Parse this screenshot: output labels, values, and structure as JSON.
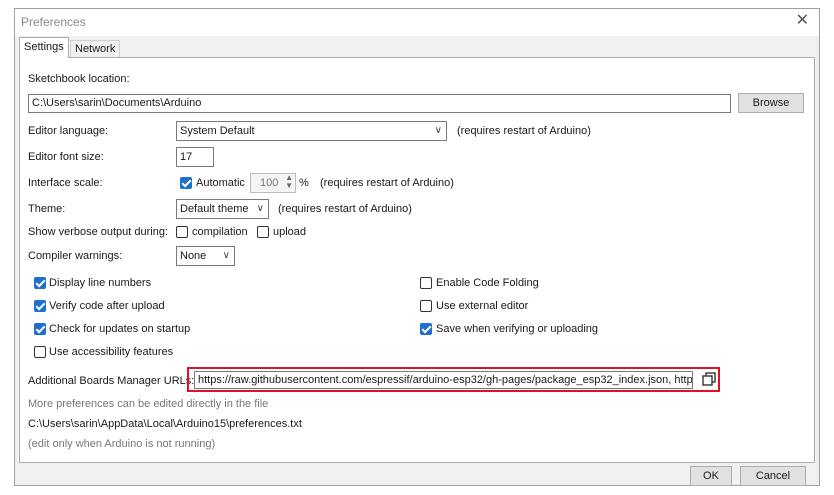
{
  "window": {
    "title": "Preferences"
  },
  "tabs": [
    "Settings",
    "Network"
  ],
  "sketchbook": {
    "label": "Sketchbook location:",
    "value": "C:\\Users\\sarin\\Documents\\Arduino",
    "browse": "Browse"
  },
  "editor_language": {
    "label": "Editor language:",
    "value": "System Default",
    "note": "(requires restart of Arduino)"
  },
  "font_size": {
    "label": "Editor font size:",
    "value": "17"
  },
  "interface_scale": {
    "label": "Interface scale:",
    "automatic": "Automatic",
    "automatic_checked": true,
    "value": "100",
    "unit": "%",
    "note": "(requires restart of Arduino)"
  },
  "theme": {
    "label": "Theme:",
    "value": "Default theme",
    "note": "(requires restart of Arduino)"
  },
  "verbose": {
    "label": "Show verbose output during:",
    "compilation": "compilation",
    "upload": "upload",
    "compilation_checked": false,
    "upload_checked": false
  },
  "compiler_warnings": {
    "label": "Compiler warnings:",
    "value": "None"
  },
  "options_left": [
    {
      "label": "Display line numbers",
      "checked": true
    },
    {
      "label": "Verify code after upload",
      "checked": true
    },
    {
      "label": "Check for updates on startup",
      "checked": true
    },
    {
      "label": "Use accessibility features",
      "checked": false
    }
  ],
  "options_right": [
    {
      "label": "Enable Code Folding",
      "checked": false
    },
    {
      "label": "Use external editor",
      "checked": false
    },
    {
      "label": "Save when verifying or uploading",
      "checked": true
    }
  ],
  "boards_urls": {
    "label": "Additional Boards Manager URLs:",
    "value": "https://raw.githubusercontent.com/espressif/arduino-esp32/gh-pages/package_esp32_index.json, http"
  },
  "more_prefs": {
    "line1": "More preferences can be edited directly in the file",
    "path": "C:\\Users\\sarin\\AppData\\Local\\Arduino15\\preferences.txt",
    "line3": "(edit only when Arduino is not running)"
  },
  "buttons": {
    "ok": "OK",
    "cancel": "Cancel"
  },
  "colors": {
    "highlight": "#e0102a",
    "checkbox_on": "#1f6fd1"
  }
}
